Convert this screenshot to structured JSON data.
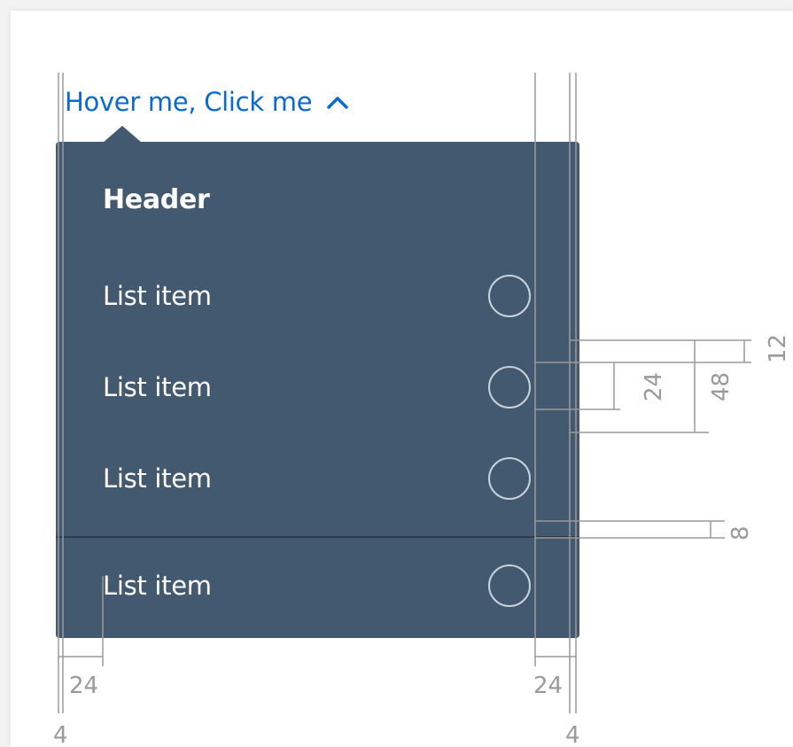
{
  "dropdown": {
    "trigger_label": "Hover me, Click me",
    "trigger_icon": "chevron-up-icon",
    "header": "Header",
    "items": [
      {
        "label": "List item"
      },
      {
        "label": "List item"
      },
      {
        "label": "List item"
      },
      {
        "label": "List item"
      }
    ]
  },
  "annotations": {
    "padding_left": "24",
    "padding_right": "24",
    "edge_left": "4",
    "edge_right": "4",
    "radio_size": "24",
    "row_height": "48",
    "row_padding": "12",
    "divider_spacing": "8"
  },
  "colors": {
    "link": "#0a6ad0",
    "menu_background": "#42596f",
    "menu_text": "#ffffff",
    "guide_lines": "#9a9a9a"
  }
}
